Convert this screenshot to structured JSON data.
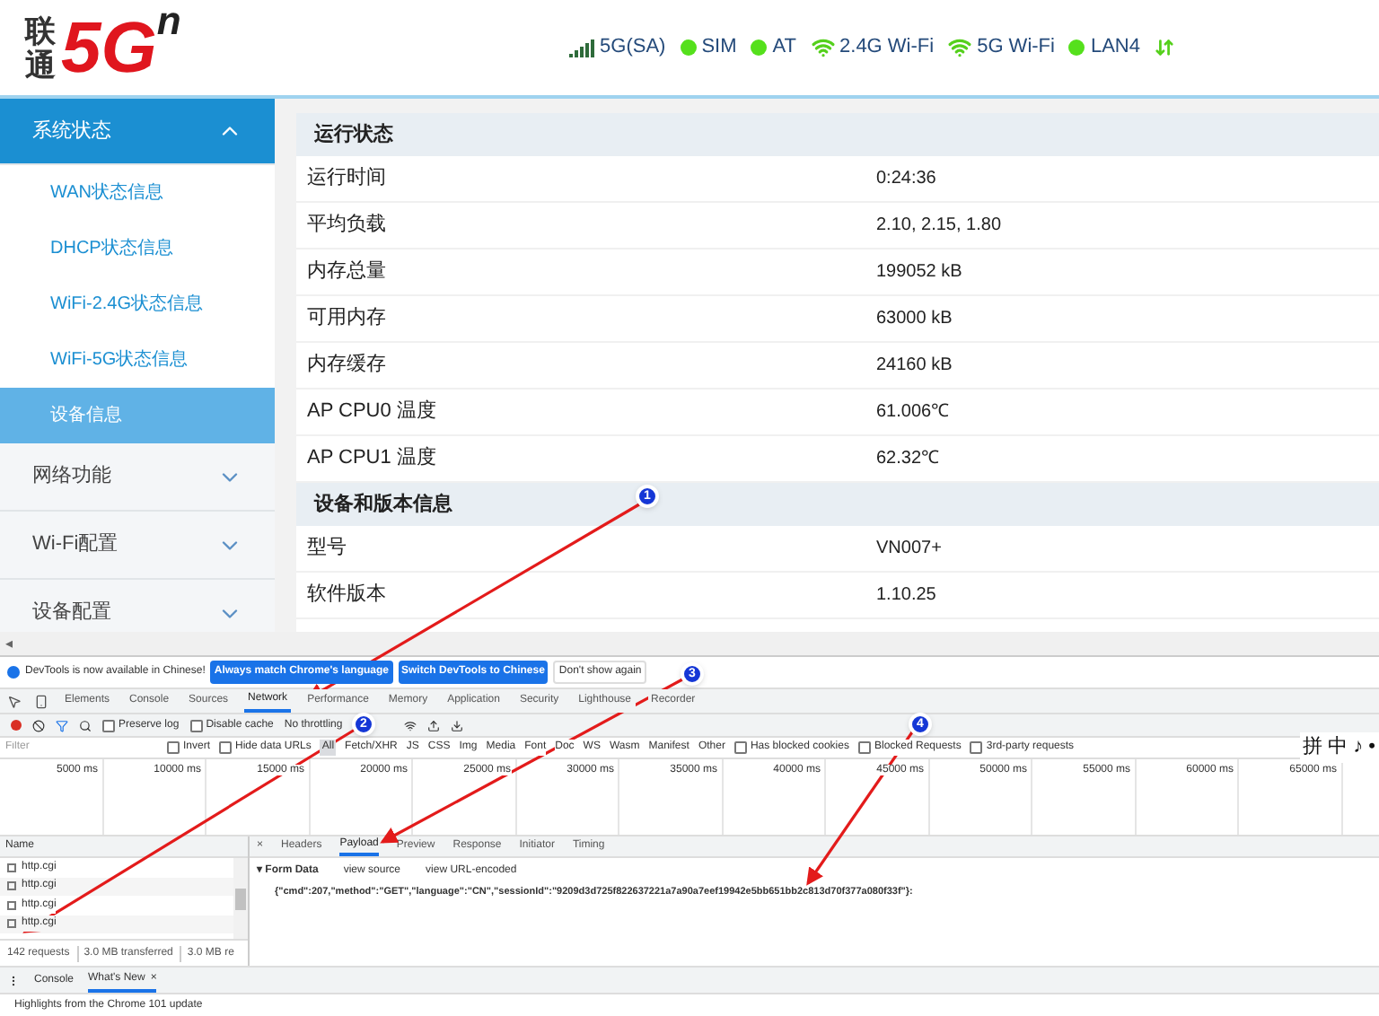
{
  "header": {
    "logo": {
      "cn": "联通",
      "text": "5G",
      "sup": "n"
    },
    "status": [
      {
        "kind": "signal",
        "label": "5G(SA)"
      },
      {
        "kind": "dot",
        "label": "SIM"
      },
      {
        "kind": "dot",
        "label": "AT"
      },
      {
        "kind": "wifi",
        "label": "2.4G Wi-Fi"
      },
      {
        "kind": "wifi",
        "label": "5G Wi-Fi"
      },
      {
        "kind": "dot",
        "label": "LAN4"
      },
      {
        "kind": "transfer"
      }
    ]
  },
  "sidebar": [
    {
      "label": "系统状态",
      "expanded": true,
      "children": [
        {
          "label": "WAN状态信息",
          "selected": false
        },
        {
          "label": "DHCP状态信息",
          "selected": false
        },
        {
          "label": "WiFi-2.4G状态信息",
          "selected": false
        },
        {
          "label": "WiFi-5G状态信息",
          "selected": false
        },
        {
          "label": "设备信息",
          "selected": true
        }
      ]
    },
    {
      "label": "网络功能",
      "expanded": false
    },
    {
      "label": "Wi-Fi配置",
      "expanded": false
    },
    {
      "label": "设备配置",
      "expanded": false
    }
  ],
  "sections": [
    {
      "title": "运行状态",
      "rows": [
        {
          "label": "运行时间",
          "value": "0:24:36"
        },
        {
          "label": "平均负载",
          "value": "2.10, 2.15, 1.80"
        },
        {
          "label": "内存总量",
          "value": "199052 kB"
        },
        {
          "label": "可用内存",
          "value": "63000 kB"
        },
        {
          "label": "内存缓存",
          "value": "24160 kB"
        },
        {
          "label": "AP CPU0 温度",
          "value": "61.006℃"
        },
        {
          "label": "AP CPU1 温度",
          "value": "62.32℃"
        }
      ]
    },
    {
      "title": "设备和版本信息",
      "rows": [
        {
          "label": "型号",
          "value": "VN007+"
        },
        {
          "label": "软件版本",
          "value": "1.10.25"
        }
      ]
    }
  ],
  "scroll_arrow": "◂",
  "devtools": {
    "info": {
      "text": "DevTools is now available in Chinese!",
      "buttons": [
        "Always match Chrome's language",
        "Switch DevTools to Chinese"
      ],
      "dismiss": "Don't show again"
    },
    "tabs": [
      {
        "label": "Elements",
        "selected": false
      },
      {
        "label": "Console",
        "selected": false
      },
      {
        "label": "Sources",
        "selected": false
      },
      {
        "label": "Network",
        "selected": true
      },
      {
        "label": "Performance",
        "selected": false
      },
      {
        "label": "Memory",
        "selected": false
      },
      {
        "label": "Application",
        "selected": false
      },
      {
        "label": "Security",
        "selected": false
      },
      {
        "label": "Lighthouse",
        "selected": false
      },
      {
        "label": "Recorder",
        "selected": false
      }
    ],
    "toolbar": {
      "preserve_log": {
        "label": "Preserve log",
        "checked": false
      },
      "disable_cache": {
        "label": "Disable cache",
        "checked": false
      },
      "throttling": "No throttling"
    },
    "filter": {
      "placeholder": "Filter",
      "options": [
        {
          "label": "Invert",
          "checked": false
        },
        {
          "label": "Hide data URLs",
          "checked": false
        }
      ],
      "types": [
        {
          "label": "All",
          "selected": true
        },
        {
          "label": "Fetch/XHR",
          "selected": false
        },
        {
          "label": "JS",
          "selected": false
        },
        {
          "label": "CSS",
          "selected": false
        },
        {
          "label": "Img",
          "selected": false
        },
        {
          "label": "Media",
          "selected": false
        },
        {
          "label": "Font",
          "selected": false
        },
        {
          "label": "Doc",
          "selected": false
        },
        {
          "label": "WS",
          "selected": false
        },
        {
          "label": "Wasm",
          "selected": false
        },
        {
          "label": "Manifest",
          "selected": false
        },
        {
          "label": "Other",
          "selected": false
        }
      ],
      "extra": [
        {
          "label": "Has blocked cookies",
          "checked": false
        },
        {
          "label": "Blocked Requests",
          "checked": false
        },
        {
          "label": "3rd-party requests",
          "checked": false
        }
      ]
    },
    "ime": [
      "拼",
      "中",
      "♪",
      "•"
    ],
    "timeline": [
      "5000 ms",
      "10000 ms",
      "15000 ms",
      "20000 ms",
      "25000 ms",
      "30000 ms",
      "35000 ms",
      "40000 ms",
      "45000 ms",
      "50000 ms",
      "55000 ms",
      "60000 ms",
      "65000 ms"
    ],
    "requests": {
      "heading": "Name",
      "items": [
        "http.cgi",
        "http.cgi",
        "http.cgi",
        "http.cgi"
      ],
      "summary": [
        "142 requests",
        "3.0 MB transferred",
        "3.0 MB re"
      ]
    },
    "detail": {
      "close": "×",
      "tabs": [
        {
          "label": "Headers",
          "selected": false
        },
        {
          "label": "Payload",
          "selected": true
        },
        {
          "label": "Preview",
          "selected": false
        },
        {
          "label": "Response",
          "selected": false
        },
        {
          "label": "Initiator",
          "selected": false
        },
        {
          "label": "Timing",
          "selected": false
        }
      ],
      "form_data": {
        "toggle": "▾",
        "title": "Form Data",
        "links": [
          "view source",
          "view URL-encoded"
        ],
        "value": "{\"cmd\":207,\"method\":\"GET\",\"language\":\"CN\",\"sessionId\":\"9209d3d725f822637221a7a90a7eef19942e5bb651bb2c813d70f377a080f33f\"}:"
      }
    },
    "drawer": {
      "tabs": [
        {
          "label": "Console",
          "selected": false
        },
        {
          "label": "What's New",
          "selected": true
        }
      ],
      "close": "×",
      "text": "Highlights from the Chrome 101 update"
    }
  },
  "annotations": [
    "1",
    "2",
    "3",
    "4"
  ]
}
